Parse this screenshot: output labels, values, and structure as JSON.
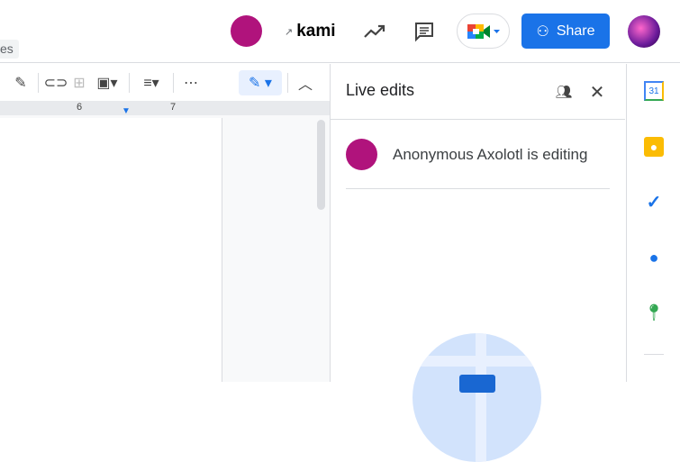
{
  "tab_fragment": "es",
  "header": {
    "addon_name": "kami",
    "share_label": "Share"
  },
  "ruler": {
    "marks": [
      "6",
      "7"
    ]
  },
  "panel": {
    "title": "Live edits",
    "editor_text": "Anonymous Axolotl is editing"
  },
  "side_panel": {
    "calendar_day": "31"
  },
  "colors": {
    "accent": "#1a73e8",
    "kami": "#b0137c"
  }
}
